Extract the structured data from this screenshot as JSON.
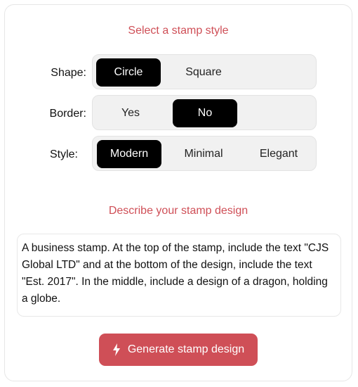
{
  "headings": {
    "style": "Select a stamp style",
    "describe": "Describe your stamp design"
  },
  "options": {
    "shape": {
      "label": "Shape:",
      "choices": [
        "Circle",
        "Square"
      ],
      "selected": "Circle"
    },
    "border": {
      "label": "Border:",
      "choices": [
        "Yes",
        "No"
      ],
      "selected": "No"
    },
    "style": {
      "label": "Style:",
      "choices": [
        "Modern",
        "Minimal",
        "Elegant"
      ],
      "selected": "Modern"
    }
  },
  "description": {
    "value": "A business stamp. At the top of the stamp, include the text \"CJS Global LTD\" and at the bottom of the design, include the text \"Est. 2017\". In the middle, include a design of a dragon, holding a globe."
  },
  "generate_button": {
    "label": "Generate stamp design",
    "icon": "lightning-bolt-icon"
  },
  "colors": {
    "accent": "#cf4f57",
    "selected_bg": "#000000",
    "segment_bg": "#f1f1f1"
  }
}
